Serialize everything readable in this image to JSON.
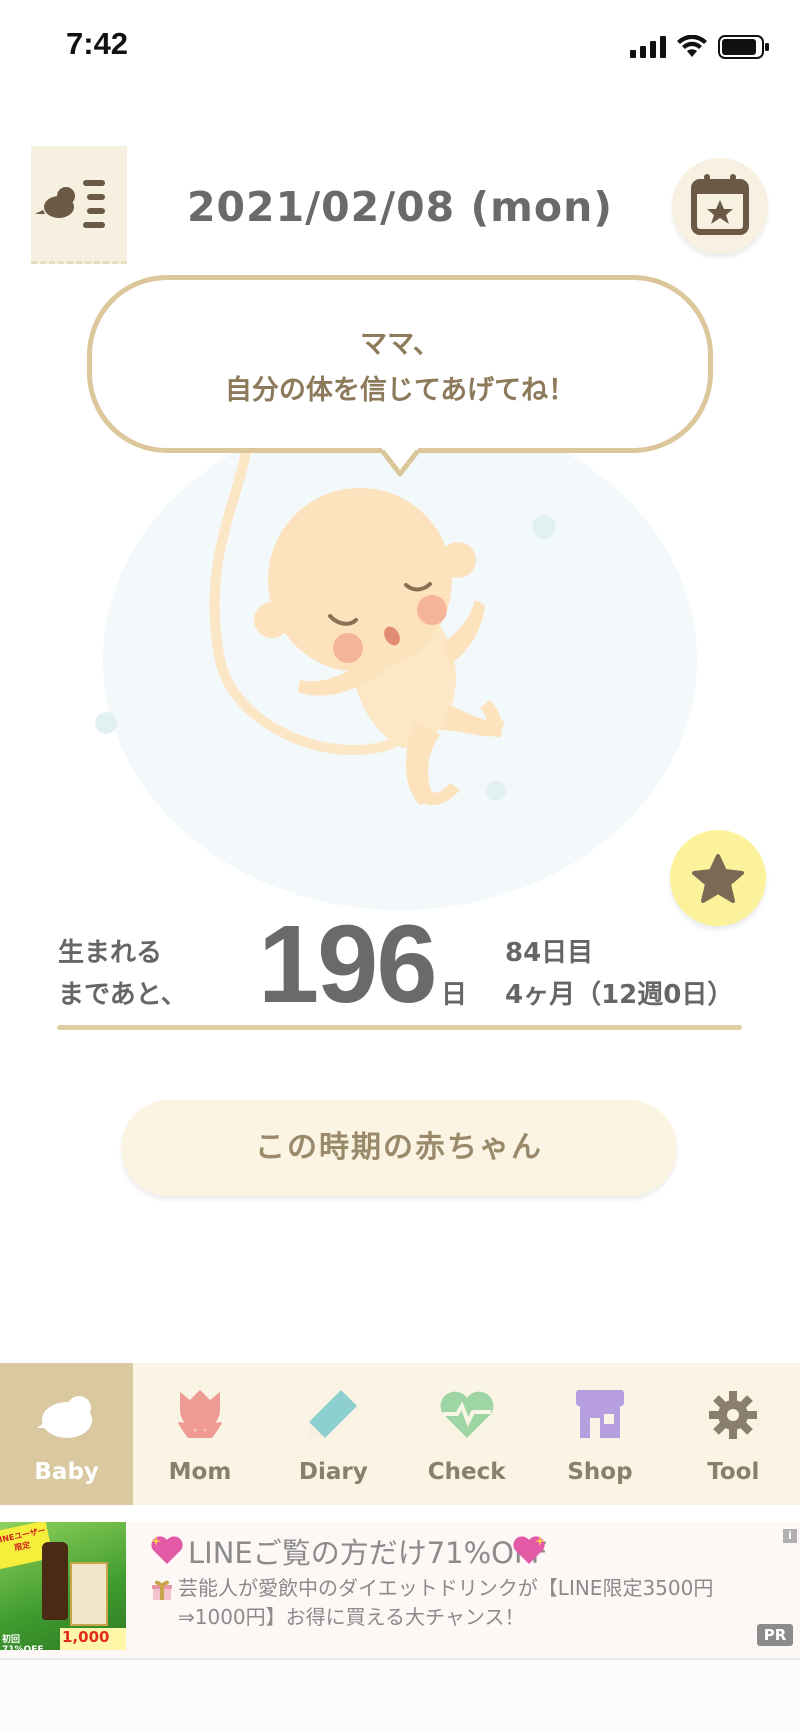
{
  "status_bar": {
    "time": "7:42"
  },
  "header": {
    "date": "2021/02/08 (mon)"
  },
  "bubble": {
    "line1": "ママ、",
    "line2": "自分の体を信じてあげてね！"
  },
  "countdown": {
    "label_line1": "生まれる",
    "label_line2": "まであと、",
    "days_remaining": "196",
    "unit": "日",
    "day_count": "84日目",
    "month_week": "4ヶ月（12週0日）"
  },
  "baby_button_label": "この時期の赤ちゃん",
  "tabs": [
    {
      "label": "Baby",
      "icon": "baby-bird-icon",
      "color": "#ffffff"
    },
    {
      "label": "Mom",
      "icon": "tulip-icon",
      "color": "#ef9a93"
    },
    {
      "label": "Diary",
      "icon": "pencil-icon",
      "color": "#8ecfcf"
    },
    {
      "label": "Check",
      "icon": "heart-pulse-icon",
      "color": "#9fd4a5"
    },
    {
      "label": "Shop",
      "icon": "shop-icon",
      "color": "#b79ee0"
    },
    {
      "label": "Tool",
      "icon": "gear-icon",
      "color": "#8a7f6c"
    }
  ],
  "ad": {
    "title": "LINEご覧の方だけ71%OFF",
    "body": "芸能人が愛飲中のダイエットドリンクが【LINE限定3500円⇒1000円】お得に買える大チャンス！",
    "badge_pr": "PR",
    "badge_info": "i",
    "image_text_top": "LINEユーザー限定",
    "image_text_bottom": "初回71%OFF",
    "image_price": "1,000円"
  },
  "colors": {
    "accent_gold": "#dcc79b",
    "tab_bg": "#faf4e4",
    "tab_active": "#d9c8a0",
    "star_bg": "#fbf29b"
  }
}
